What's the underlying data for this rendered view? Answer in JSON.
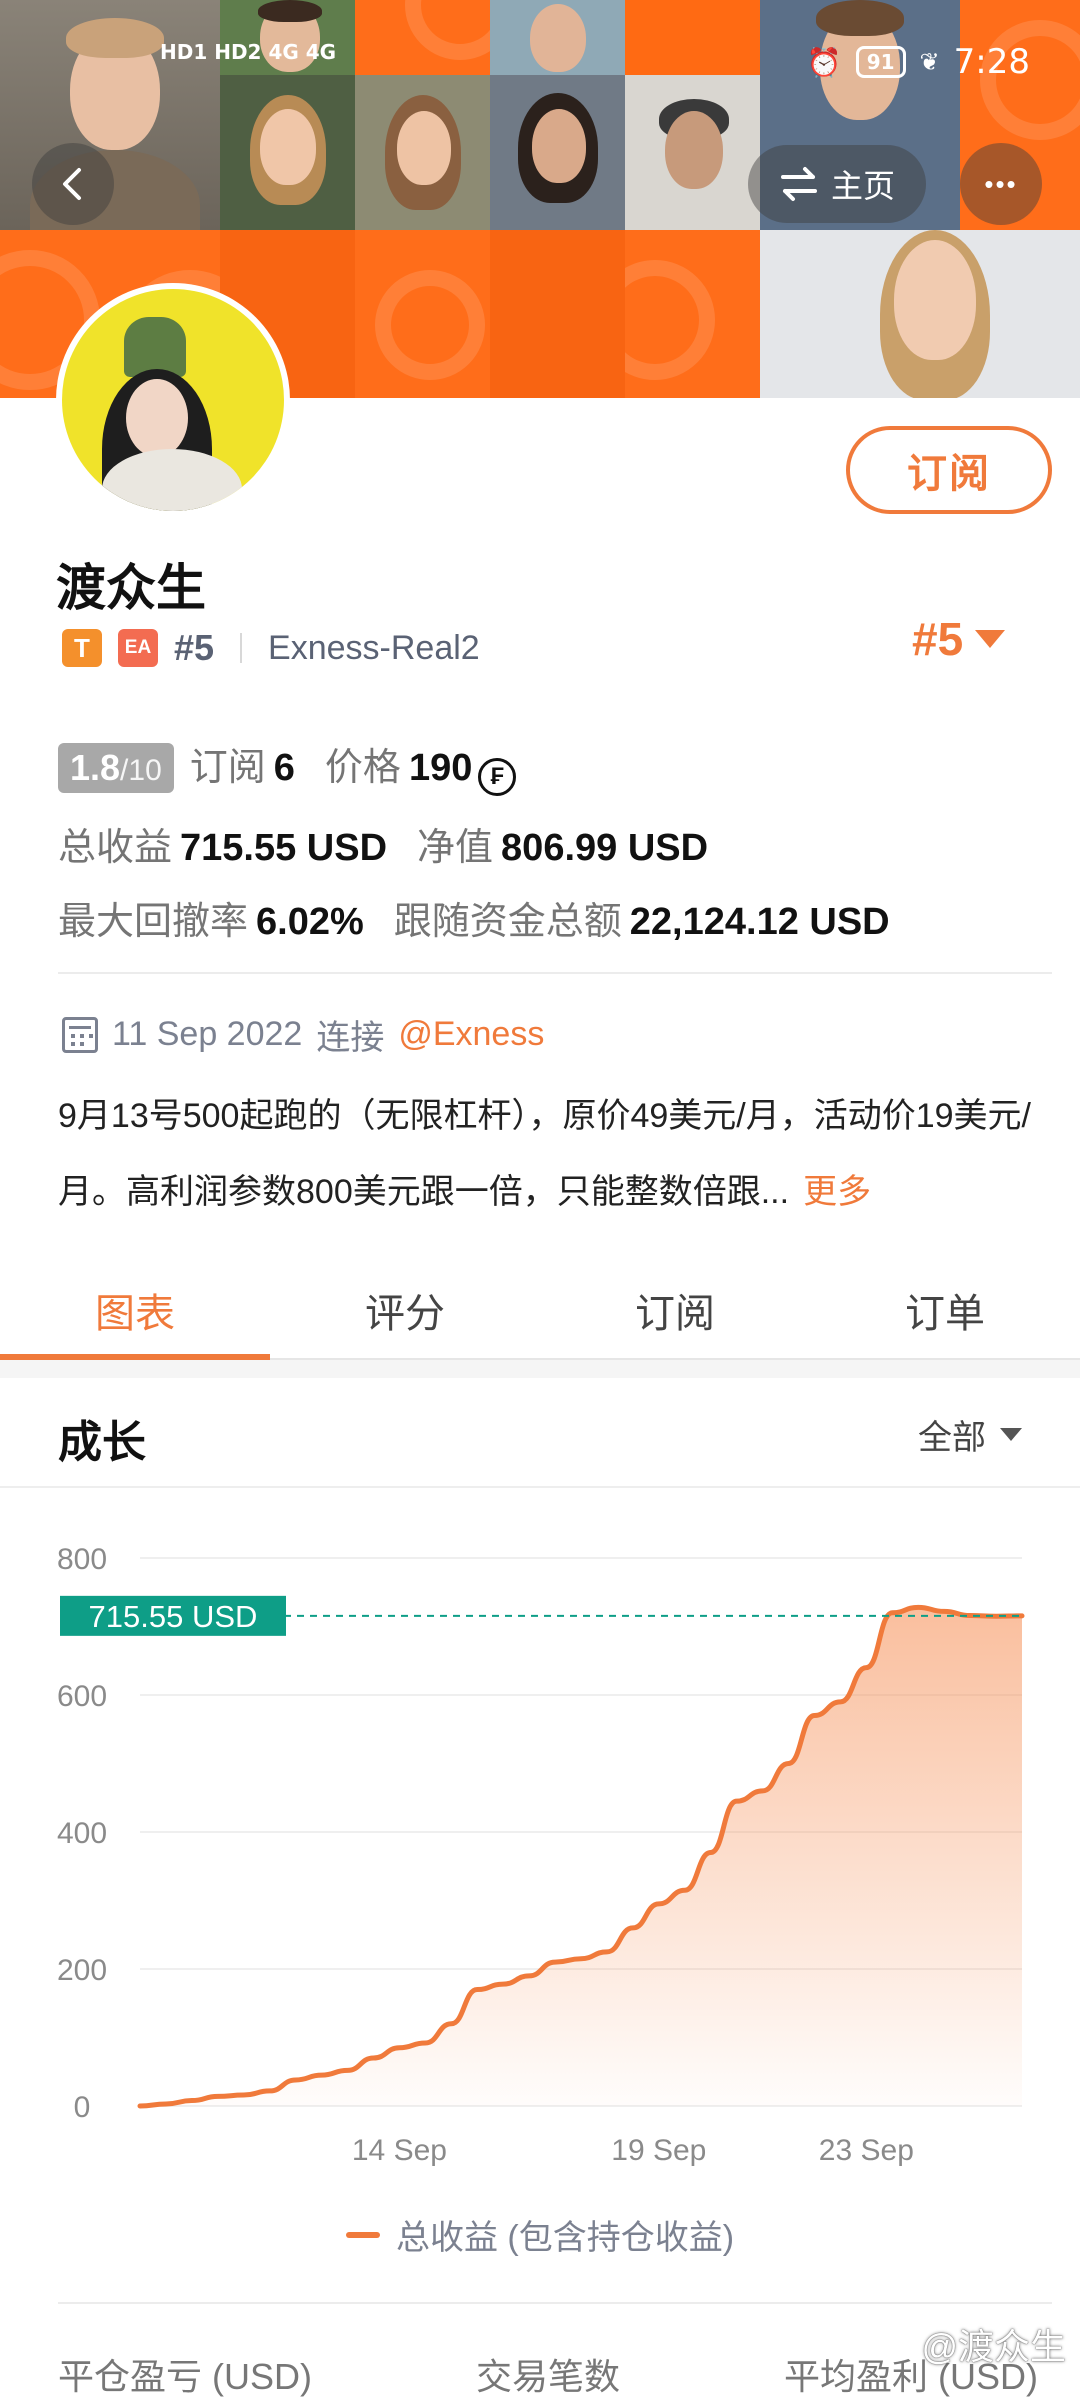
{
  "status_bar": {
    "left_indicators": "HD1 HD2  4G  4G",
    "battery": "91",
    "time": "7:28"
  },
  "header": {
    "home_label": "主页",
    "more_label": "•••"
  },
  "profile": {
    "name": "渡众生",
    "tag_t": "T",
    "tag_ea": "EA",
    "rank_small": "#5",
    "account": "Exness-Real2",
    "rank_big": "#5",
    "subscribe_label": "订阅"
  },
  "stats": {
    "score": "1.8",
    "score_max": "/10",
    "subscribe_label": "订阅",
    "subscribe_count": "6",
    "price_label": "价格",
    "price_value": "190",
    "coin_symbol": "₣",
    "total_profit_label": "总收益",
    "total_profit_value": "715.55 USD",
    "equity_label": "净值",
    "equity_value": "806.99 USD",
    "drawdown_label": "最大回撤率",
    "drawdown_value": "6.02%",
    "follow_funds_label": "跟随资金总额",
    "follow_funds_value": "22,124.12 USD"
  },
  "info": {
    "date": "11 Sep 2022",
    "connect_label": "连接",
    "broker": "@Exness",
    "description": "9月13号500起跑的（无限杠杆），原价49美元/月，活动价19美元/月。高利润参数800美元跟一倍，只能整数倍跟...",
    "more_label": "更多"
  },
  "tabs": [
    {
      "label": "图表",
      "active": true
    },
    {
      "label": "评分",
      "active": false
    },
    {
      "label": "订阅",
      "active": false
    },
    {
      "label": "订单",
      "active": false
    }
  ],
  "growth": {
    "title": "成长",
    "range_label": "全部"
  },
  "chart_data": {
    "type": "area",
    "title": "",
    "ylim": [
      0,
      800
    ],
    "yticks": [
      0,
      200,
      400,
      600,
      800
    ],
    "xtick_labels": [
      "14 Sep",
      "19 Sep",
      "23 Sep"
    ],
    "xtick_positions": [
      5,
      10,
      14
    ],
    "xlim": [
      0,
      17
    ],
    "current_value_label": "715.55 USD",
    "current_value": 715.55,
    "line_color": "#f07a3b",
    "label_color": "#0e9e87",
    "series": [
      {
        "name": "总收益 (包含持仓收益)",
        "x": [
          0,
          0.5,
          1,
          1.5,
          2,
          2.5,
          3,
          3.5,
          4,
          4.5,
          5,
          5.5,
          6,
          6.5,
          7,
          7.5,
          8,
          8.5,
          9,
          9.5,
          10,
          10.5,
          11,
          11.5,
          12,
          12.5,
          13,
          13.5,
          14,
          14.5,
          15,
          15.5,
          16,
          16.5,
          17
        ],
        "y": [
          0,
          3,
          8,
          14,
          16,
          22,
          38,
          45,
          52,
          70,
          85,
          92,
          120,
          170,
          178,
          190,
          210,
          215,
          225,
          260,
          295,
          315,
          370,
          445,
          460,
          500,
          570,
          590,
          640,
          720,
          728,
          722,
          716,
          715,
          715.55
        ]
      }
    ]
  },
  "legend": {
    "label": "总收益 (包含持仓收益)"
  },
  "bottom_stats": {
    "closed_pnl_label": "平仓盈亏 (USD)",
    "trades_label": "交易笔数",
    "avg_profit_label": "平均盈利 (USD)"
  },
  "watermark": "@渡众生"
}
